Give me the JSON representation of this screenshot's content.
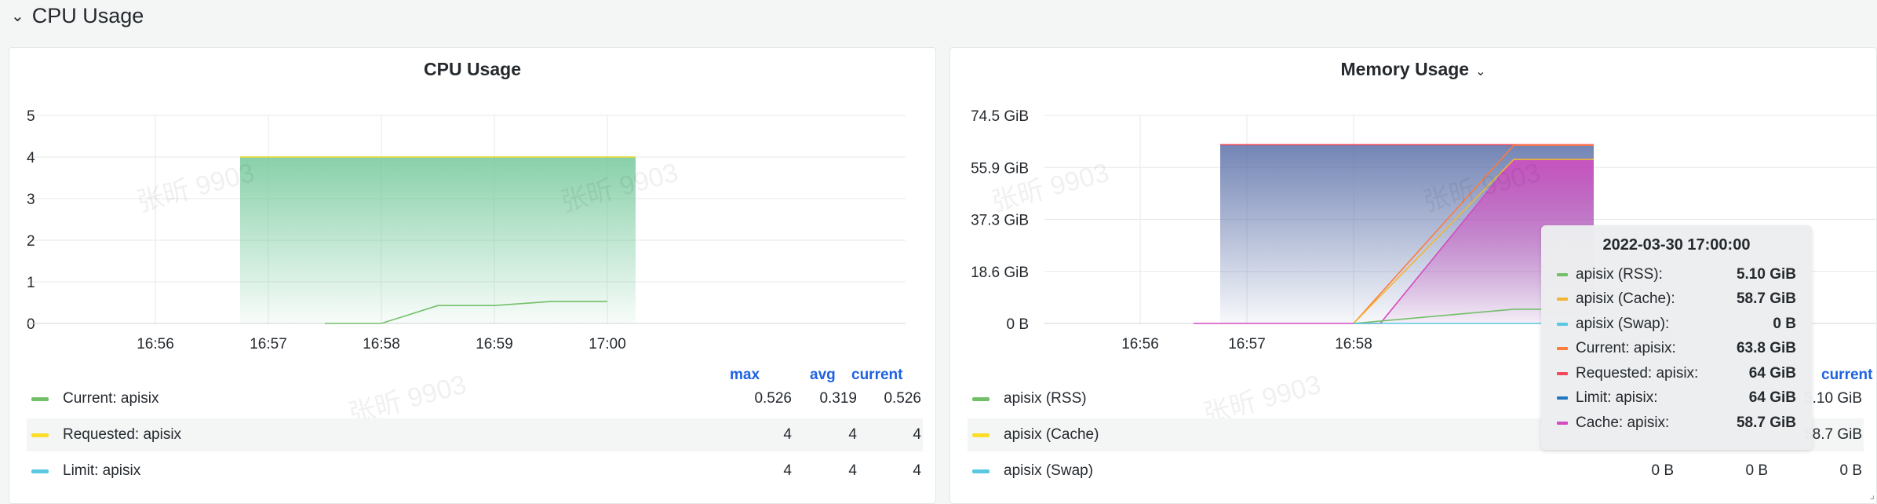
{
  "row": {
    "title": "CPU Usage"
  },
  "panels": {
    "cpu": {
      "title": "CPU Usage",
      "legend_headers": [
        "max",
        "avg",
        "current"
      ],
      "legend": [
        {
          "name": "Current: apisix",
          "color": "#73bf69",
          "max": "0.526",
          "avg": "0.319",
          "current": "0.526"
        },
        {
          "name": "Requested: apisix",
          "color": "#fade2a",
          "max": "4",
          "avg": "4",
          "current": "4"
        },
        {
          "name": "Limit: apisix",
          "color": "#5ac8e0",
          "max": "4",
          "avg": "4",
          "current": "4"
        }
      ]
    },
    "mem": {
      "title": "Memory Usage",
      "legend_headers": [
        "current"
      ],
      "legend": [
        {
          "name": "apisix (RSS)",
          "color": "#73bf69",
          "max": "",
          "avg": "",
          "current": "5.10 GiB"
        },
        {
          "name": "apisix (Cache)",
          "color": "#fade2a",
          "max": "",
          "avg": "",
          "current": "58.7 GiB"
        },
        {
          "name": "apisix (Swap)",
          "color": "#5ac8e0",
          "max": "0 B",
          "avg": "0 B",
          "current": "0 B"
        }
      ]
    }
  },
  "tooltip": {
    "title": "2022-03-30 17:00:00",
    "rows": [
      {
        "name": "apisix (RSS):",
        "color": "#73bf69",
        "value": "5.10 GiB"
      },
      {
        "name": "apisix (Cache):",
        "color": "#f2b536",
        "value": "58.7 GiB"
      },
      {
        "name": "apisix (Swap):",
        "color": "#5ac8e0",
        "value": "0 B"
      },
      {
        "name": "Current: apisix:",
        "color": "#ff7a3d",
        "value": "63.8 GiB"
      },
      {
        "name": "Requested: apisix:",
        "color": "#f2495c",
        "value": "64 GiB"
      },
      {
        "name": "Limit: apisix:",
        "color": "#1f78c1",
        "value": "64 GiB"
      },
      {
        "name": "Cache: apisix:",
        "color": "#d44ac0",
        "value": "58.7 GiB"
      }
    ]
  },
  "chart_data": [
    {
      "type": "area",
      "title": "CPU Usage",
      "x": [
        "16:56",
        "16:57",
        "16:58",
        "16:59",
        "17:00"
      ],
      "ylim": [
        0,
        5
      ],
      "yticks": [
        "0",
        "1",
        "2",
        "3",
        "4",
        "5"
      ],
      "grid": true,
      "series": [
        {
          "name": "Limit: apisix",
          "color": "#5ac8e0",
          "points": [
            [
              "16:56:45",
              4
            ],
            [
              "17:00:15",
              4
            ]
          ]
        },
        {
          "name": "Requested: apisix",
          "color": "#fade2a",
          "points": [
            [
              "16:56:45",
              4
            ],
            [
              "17:00:15",
              4
            ]
          ]
        },
        {
          "name": "Current: apisix",
          "color": "#73bf69",
          "points": [
            [
              "16:57:30",
              0
            ],
            [
              "16:58:00",
              0
            ],
            [
              "16:58:30",
              0.43
            ],
            [
              "16:59:00",
              0.43
            ],
            [
              "16:59:30",
              0.526
            ],
            [
              "17:00:00",
              0.526
            ]
          ]
        }
      ]
    },
    {
      "type": "area",
      "title": "Memory Usage",
      "x": [
        "16:56",
        "16:57",
        "16:58"
      ],
      "ylim": [
        0,
        74.5
      ],
      "yticks": [
        "0 B",
        "18.6 GiB",
        "37.3 GiB",
        "55.9 GiB",
        "74.5 GiB"
      ],
      "grid": true,
      "series": [
        {
          "name": "Limit: apisix",
          "color": "#1f78c1",
          "points": [
            [
              "16:56:45",
              64
            ],
            [
              "17:00:15",
              64
            ]
          ]
        },
        {
          "name": "Requested: apisix",
          "color": "#f2495c",
          "points": [
            [
              "16:56:45",
              64
            ],
            [
              "17:00:15",
              64
            ]
          ]
        },
        {
          "name": "Current: apisix",
          "color": "#ff7a3d",
          "points": [
            [
              "16:58:00",
              0
            ],
            [
              "16:59:30",
              63.8
            ],
            [
              "17:00:15",
              63.8
            ]
          ]
        },
        {
          "name": "Cache: apisix",
          "color": "#d44ac0",
          "points": [
            [
              "16:56:30",
              0
            ],
            [
              "16:58:15",
              0
            ],
            [
              "16:59:30",
              58.7
            ],
            [
              "17:00:15",
              58.7
            ]
          ]
        },
        {
          "name": "apisix (Cache)",
          "color": "#f2b536",
          "points": [
            [
              "16:58:00",
              0
            ],
            [
              "16:59:30",
              58.7
            ],
            [
              "17:00:15",
              58.7
            ]
          ]
        },
        {
          "name": "apisix (RSS)",
          "color": "#73bf69",
          "points": [
            [
              "16:58:00",
              0
            ],
            [
              "16:59:30",
              5.1
            ],
            [
              "17:00:15",
              5.1
            ]
          ]
        },
        {
          "name": "apisix (Swap)",
          "color": "#5ac8e0",
          "points": [
            [
              "16:58:00",
              0
            ],
            [
              "17:00:15",
              0
            ]
          ]
        }
      ]
    }
  ]
}
